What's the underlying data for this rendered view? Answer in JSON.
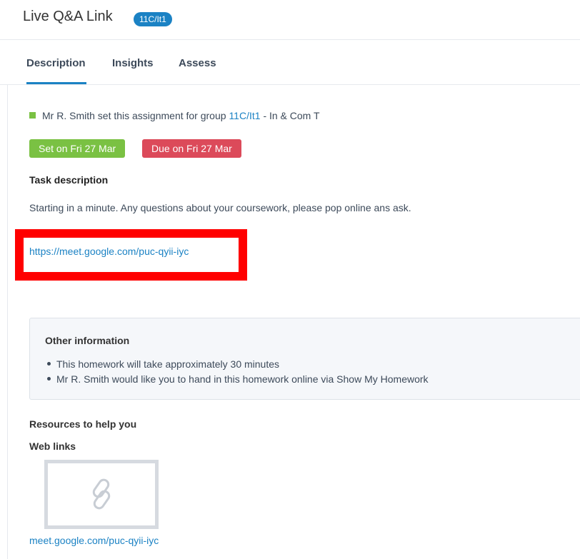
{
  "header": {
    "title": "Live Q&A Link",
    "group_badge": "11C/It1"
  },
  "tabs": [
    {
      "label": "Description",
      "active": true
    },
    {
      "label": "Insights",
      "active": false
    },
    {
      "label": "Assess",
      "active": false
    }
  ],
  "assignment": {
    "set_by_prefix": "Mr R. Smith set this assignment for group",
    "group_link": "11C/It1",
    "set_by_suffix": "- In & Com T",
    "set_date": "Set on Fri 27 Mar",
    "due_date": "Due on Fri 27 Mar"
  },
  "task": {
    "heading": "Task description",
    "text": "Starting in a minute. Any questions about your coursework, please pop online ans ask.",
    "link": "https://meet.google.com/puc-qyii-iyc"
  },
  "other_info": {
    "heading": "Other information",
    "items": [
      "This homework will take approximately 30 minutes",
      "Mr R. Smith would like you to hand in this homework online via Show My Homework"
    ]
  },
  "resources": {
    "heading": "Resources to help you",
    "weblinks_heading": "Web links",
    "weblink_label": "meet.google.com/puc-qyii-iyc",
    "weblink_icon": "link-icon"
  },
  "colors": {
    "accent": "#1b82c4",
    "set_green": "#7ac143",
    "due_red": "#dc4a5a",
    "highlight": "#ff0000"
  }
}
